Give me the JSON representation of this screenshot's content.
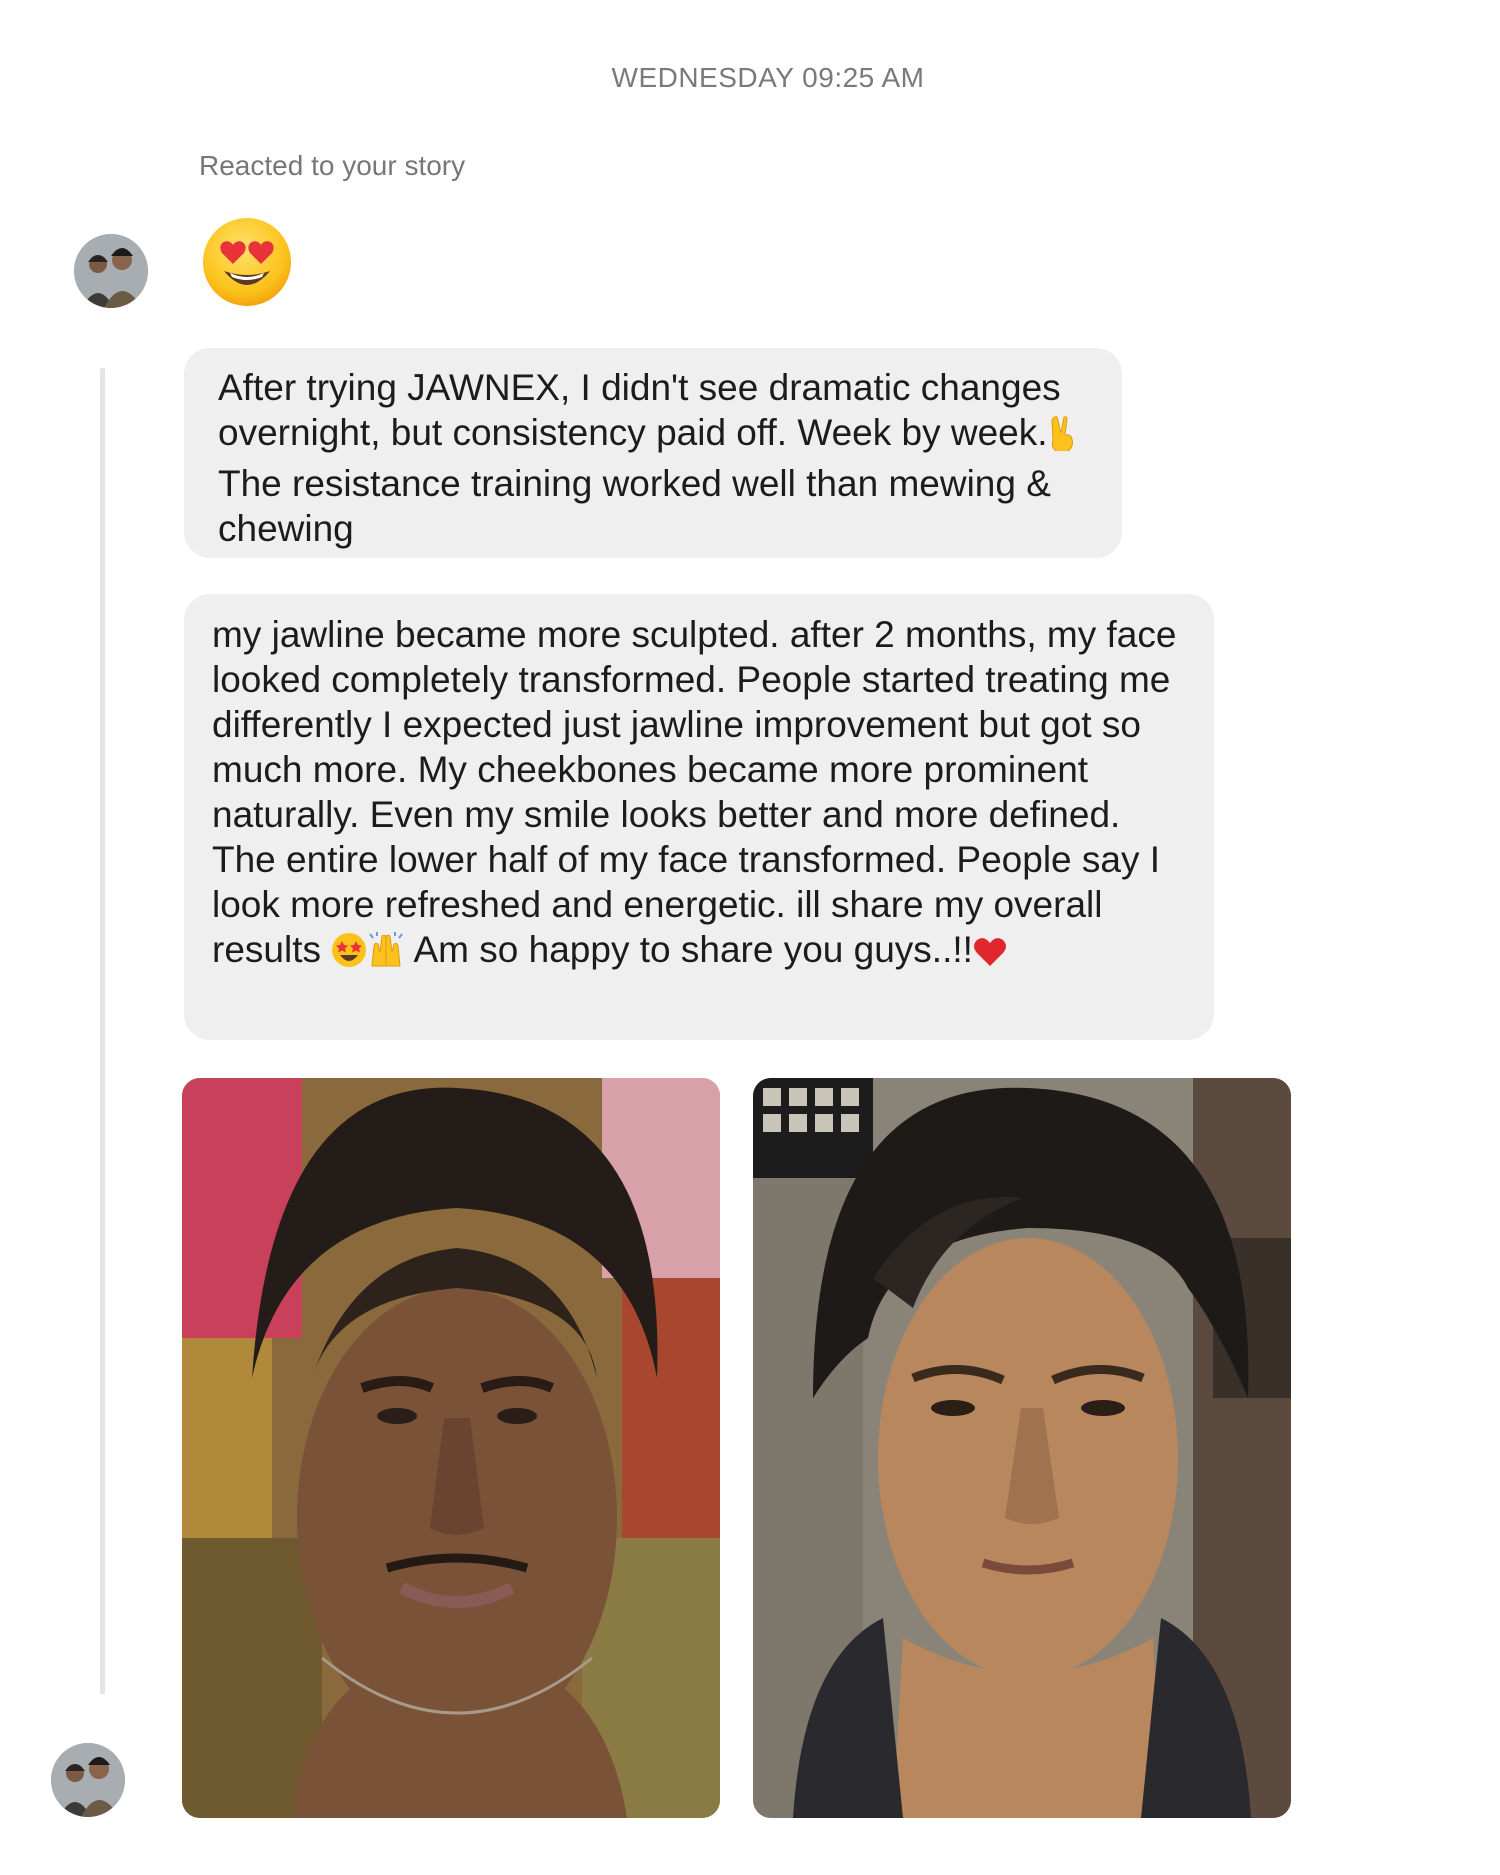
{
  "thread": {
    "timestamp": "WEDNESDAY 09:25 AM",
    "story_reaction": {
      "label": "Reacted to your story",
      "emoji": "heart-eyes-face"
    },
    "messages": [
      {
        "text_before_emoji": "After trying JAWNEX, I didn't see dramatic changes overnight, but consistency paid off. Week by week.",
        "emoji": "victory-hand",
        "text_after_emoji": " The resistance training worked well than mewing & chewing"
      },
      {
        "text_before_emoji": "my jawline became more sculpted. after 2 months, my face looked completely transformed. People started treating me differently I expected just jawline improvement but got so much more. My cheekbones became more prominent naturally. Even my smile looks better and more defined. The entire lower half of my face transformed. People say I look more refreshed and energetic. ill share my overall results ",
        "emojis_middle": [
          "star-struck-face",
          "raising-hands"
        ],
        "text_middle": " Am so happy to share you guys..!!",
        "emoji_end": "red-heart"
      }
    ],
    "photos": [
      {
        "subject": "before-photo"
      },
      {
        "subject": "after-photo"
      }
    ]
  },
  "colors": {
    "bubble": "#efefef",
    "timestamp": "#7a7a7a",
    "thread_line": "#e4e4e4",
    "heart": "#e0262f"
  }
}
